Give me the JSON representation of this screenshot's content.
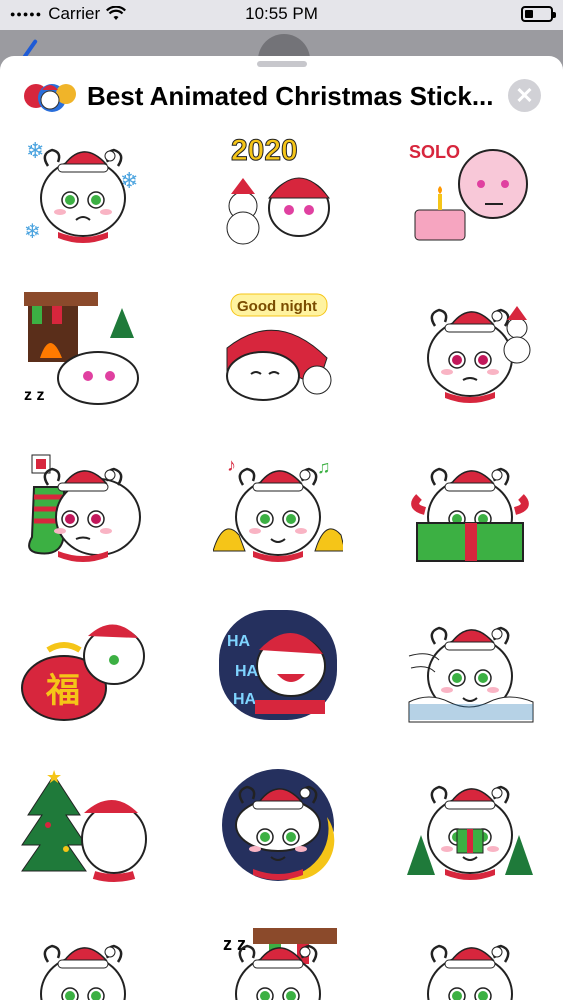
{
  "status_bar": {
    "carrier": "Carrier",
    "time": "10:55 PM",
    "battery_level": 0.35
  },
  "sheet": {
    "title": "Best Animated Christmas Stick...",
    "close_icon": "close-icon"
  },
  "stickers": [
    {
      "text": "",
      "kind": "crying-snowflakes"
    },
    {
      "text": "2020",
      "kind": "snowman-2020"
    },
    {
      "text": "SOLO",
      "kind": "solo-cake"
    },
    {
      "text": "",
      "kind": "fireplace-sleep"
    },
    {
      "text": "Good night",
      "kind": "good-night"
    },
    {
      "text": "",
      "kind": "angry-snowman"
    },
    {
      "text": "",
      "kind": "stocking"
    },
    {
      "text": "",
      "kind": "bells-dance"
    },
    {
      "text": "",
      "kind": "gift-box"
    },
    {
      "text": "福",
      "kind": "lucky-bag"
    },
    {
      "text": "HA HA HA",
      "kind": "laughing"
    },
    {
      "text": "",
      "kind": "snow-wind"
    },
    {
      "text": "",
      "kind": "christmas-tree"
    },
    {
      "text": "",
      "kind": "moon"
    },
    {
      "text": "",
      "kind": "gift-trees"
    },
    {
      "text": "",
      "kind": "partial-1"
    },
    {
      "text": "",
      "kind": "partial-2"
    },
    {
      "text": "",
      "kind": "partial-3"
    }
  ]
}
